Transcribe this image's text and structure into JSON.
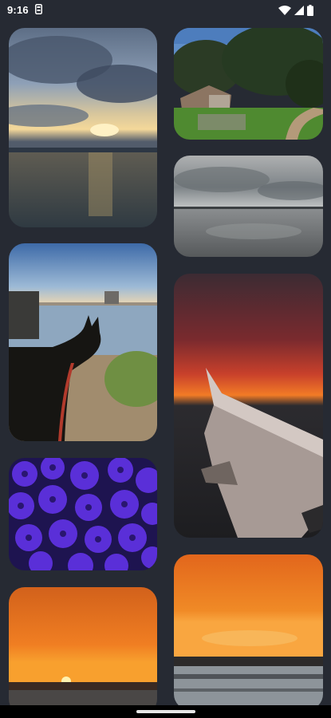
{
  "status_bar": {
    "time": "9:16",
    "notification_icon": "storage-icon",
    "icons": [
      "wifi-icon",
      "cell-signal-icon",
      "battery-icon"
    ]
  },
  "gallery": {
    "photos": [
      {
        "subject": "sunset-clouds-over-water"
      },
      {
        "subject": "house-with-trees-and-path"
      },
      {
        "subject": "overcast-sky-beach"
      },
      {
        "subject": "dog-at-shoreline"
      },
      {
        "subject": "airplane-wing-at-sunset"
      },
      {
        "subject": "purple-flowers"
      },
      {
        "subject": "orange-sunset-horizon"
      },
      {
        "subject": "orange-sunset-over-water"
      }
    ]
  },
  "nav_bar": {
    "handle_icon": "gesture-handle-icon"
  }
}
